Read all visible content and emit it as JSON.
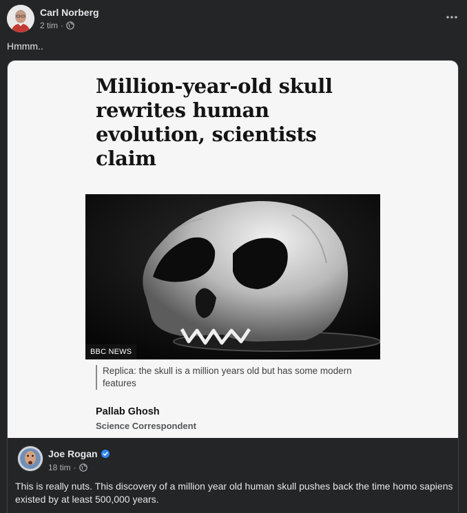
{
  "post": {
    "author": "Carl Norberg",
    "time": "2 tim",
    "text": "Hmmm.."
  },
  "article": {
    "headline": "Million-year-old skull rewrites human evolution, scientists claim",
    "image_badge": "BBC NEWS",
    "caption": "Replica: the skull is a million years old but has some modern features",
    "byline_name": "Pallab Ghosh",
    "byline_role": "Science Correspondent"
  },
  "shared": {
    "author": "Joe Rogan",
    "time": "18 tim",
    "text": "This is really nuts.  This discovery of a million year old human skull pushes back the time homo sapiens existed  by at least 500,000 years."
  },
  "icons": {
    "privacy": "globe-icon",
    "more": "more-options-icon",
    "verified": "verified-badge-icon"
  },
  "colors": {
    "background": "#242526",
    "text": "#e4e6eb",
    "secondary_text": "#b0b3b8",
    "verified": "#2d88ff",
    "article_bg": "#f6f6f6"
  }
}
